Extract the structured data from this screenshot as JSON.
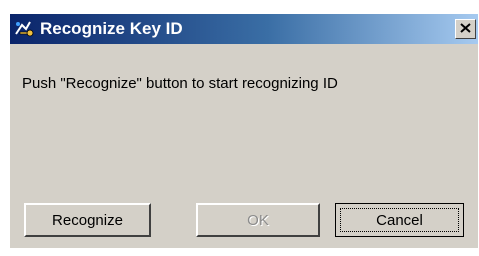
{
  "window": {
    "title": "Recognize Key ID",
    "close_symbol": "✕",
    "icon": "key-id-icon",
    "titlebar_colors": [
      "#0a246a",
      "#3a6ea5",
      "#a6caf0"
    ]
  },
  "content": {
    "message": "Push \"Recognize\" button to start recognizing ID"
  },
  "buttons": {
    "recognize": "Recognize",
    "ok": "OK",
    "cancel": "Cancel"
  }
}
